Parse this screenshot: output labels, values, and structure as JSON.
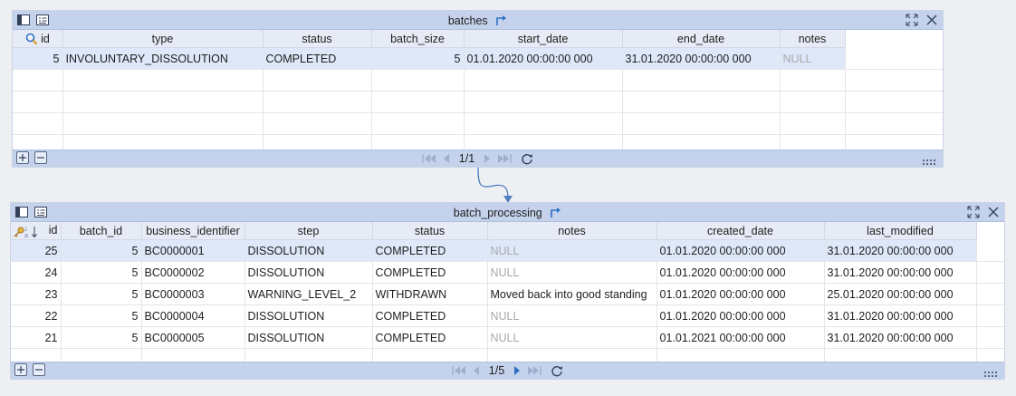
{
  "batches": {
    "title": "batches",
    "columns": [
      "id",
      "type",
      "status",
      "batch_size",
      "start_date",
      "end_date",
      "notes"
    ],
    "rows": [
      [
        "5",
        "INVOLUNTARY_DISSOLUTION",
        "COMPLETED",
        "5",
        "01.01.2020 00:00:00 000",
        "31.01.2020 00:00:00 000",
        "NULL"
      ]
    ],
    "pager": "1/1"
  },
  "batch_processing": {
    "title": "batch_processing",
    "columns": [
      "id",
      "batch_id",
      "business_identifier",
      "step",
      "status",
      "notes",
      "created_date",
      "last_modified"
    ],
    "rows": [
      [
        "25",
        "5",
        "BC0000001",
        "DISSOLUTION",
        "COMPLETED",
        "NULL",
        "01.01.2020 00:00:00 000",
        "31.01.2020 00:00:00 000"
      ],
      [
        "24",
        "5",
        "BC0000002",
        "DISSOLUTION",
        "COMPLETED",
        "NULL",
        "01.01.2020 00:00:00 000",
        "31.01.2020 00:00:00 000"
      ],
      [
        "23",
        "5",
        "BC0000003",
        "WARNING_LEVEL_2",
        "WITHDRAWN",
        "Moved back into good standing",
        "01.01.2020 00:00:00 000",
        "25.01.2020 00:00:00 000"
      ],
      [
        "22",
        "5",
        "BC0000004",
        "DISSOLUTION",
        "COMPLETED",
        "NULL",
        "01.01.2020 00:00:00 000",
        "31.01.2020 00:00:00 000"
      ],
      [
        "21",
        "5",
        "BC0000005",
        "DISSOLUTION",
        "COMPLETED",
        "NULL",
        "01.01.2021 00:00:00 000",
        "31.01.2020 00:00:00 000"
      ]
    ],
    "pager": "1/5"
  },
  "colors": {
    "titlebar": "#c4d2ec",
    "header": "#e7ebf5",
    "selected_row": "#dee8f8",
    "null_text": "#a9a9a9",
    "accent": "#2f6fc4"
  },
  "icons": [
    "panel-toggle-icon",
    "record-view-icon",
    "jump-link-icon",
    "maximize-icon",
    "close-icon",
    "add-row-icon",
    "remove-row-icon",
    "first-page-icon",
    "prev-page-icon",
    "next-page-icon",
    "last-page-icon",
    "refresh-icon",
    "resize-grip-icon",
    "search-icon",
    "key-icon",
    "sort-icon"
  ]
}
